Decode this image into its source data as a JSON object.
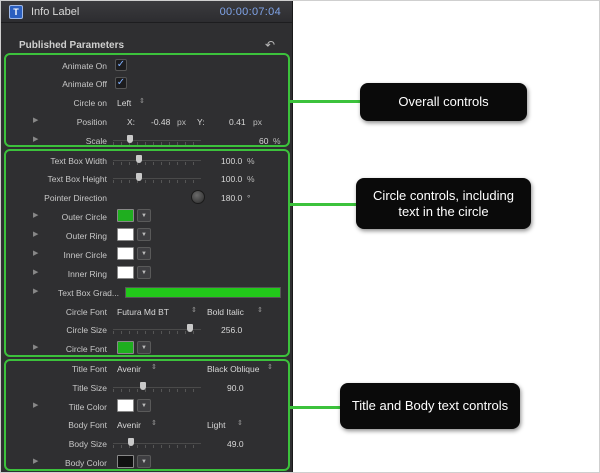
{
  "window": {
    "title": "Info Label",
    "timecode": "00:00:07:04",
    "app_icon_glyph": "T"
  },
  "section": {
    "title": "Published Parameters",
    "reset_glyph": "↶"
  },
  "overall": {
    "animate_on": {
      "label": "Animate On",
      "checked": true
    },
    "animate_off": {
      "label": "Animate Off",
      "checked": true
    },
    "circle_on": {
      "label": "Circle on",
      "value": "Left"
    },
    "position": {
      "label": "Position",
      "x_label": "X:",
      "x_value": "-0.48",
      "x_unit": "px",
      "y_label": "Y:",
      "y_value": "0.41",
      "y_unit": "px"
    },
    "scale": {
      "label": "Scale",
      "value": "60",
      "unit": "%",
      "level": 0.6
    }
  },
  "circle": {
    "text_box_width": {
      "label": "Text Box Width",
      "value": "100.0",
      "unit": "%"
    },
    "text_box_height": {
      "label": "Text Box Height",
      "value": "100.0",
      "unit": "%"
    },
    "pointer_direction": {
      "label": "Pointer Direction",
      "value": "180.0",
      "unit": "°"
    },
    "outer_circle": {
      "label": "Outer Circle",
      "color": "#1fae1f"
    },
    "outer_ring": {
      "label": "Outer Ring",
      "color": "#ffffff"
    },
    "inner_circle": {
      "label": "Inner Circle",
      "color": "#ffffff"
    },
    "inner_ring": {
      "label": "Inner Ring",
      "color": "#ffffff"
    },
    "text_box_gradient": {
      "label": "Text Box Grad...",
      "color": "#22c81a"
    },
    "circle_font": {
      "label": "Circle Font",
      "family": "Futura Md BT",
      "style": "Bold Italic"
    },
    "circle_size": {
      "label": "Circle Size",
      "value": "256.0"
    },
    "circle_font_color": {
      "label": "Circle Font",
      "color": "#1fae1f"
    }
  },
  "text": {
    "title_font": {
      "label": "Title Font",
      "family": "Avenir",
      "style": "Black Oblique"
    },
    "title_size": {
      "label": "Title Size",
      "value": "90.0"
    },
    "title_color": {
      "label": "Title Color",
      "color": "#ffffff"
    },
    "body_font": {
      "label": "Body Font",
      "family": "Avenir",
      "style": "Light"
    },
    "body_size": {
      "label": "Body Size",
      "value": "49.0"
    },
    "body_color": {
      "label": "Body Color",
      "color": "#111111"
    }
  },
  "callouts": {
    "overall": "Overall controls",
    "circle": "Circle controls, including text in the circle",
    "text": "Title and Body text controls"
  },
  "colors": {
    "highlight_green": "#3cc23c",
    "panel_bg": "#2f2f31",
    "timecode_blue": "#7fa3e8"
  }
}
